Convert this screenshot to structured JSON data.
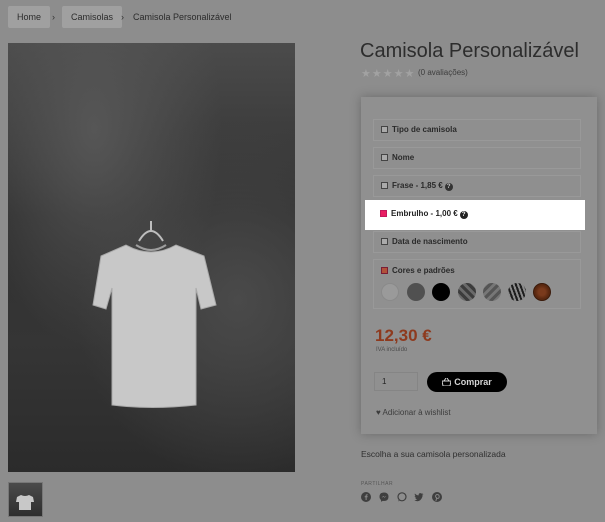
{
  "breadcrumb": {
    "home": "Home",
    "category": "Camisolas",
    "current": "Camisola Personalizável",
    "separator": "›"
  },
  "product": {
    "title": "Camisola Personalizável",
    "rating_stars": "★★★★★",
    "reviews": "(0 avaliações)",
    "price": "12,30 €",
    "vat_note": "IVA incluído",
    "quantity": "1",
    "buy_label": "Comprar",
    "wishlist_label": "Adicionar à wishlist",
    "description": "Escolha a sua camisola personalizada",
    "share_label": "PARTILHAR"
  },
  "options": {
    "tipo": "Tipo de camisola",
    "nome": "Nome",
    "frase": "Frase - 1,85 €",
    "embrulho": "Embrulho - 1,00 €",
    "data": "Data de nascimento",
    "cores": "Cores e padrões",
    "help_glyph": "?"
  },
  "colors": {
    "highlight": "#ffffff",
    "accent_price": "#8e3a1e",
    "checkbox_checked": "#e91e63",
    "buy_button": "#000000"
  },
  "icons": [
    "cart-icon",
    "heart-icon",
    "facebook-icon",
    "messenger-icon",
    "whatsapp-icon",
    "twitter-icon",
    "pinterest-icon"
  ]
}
